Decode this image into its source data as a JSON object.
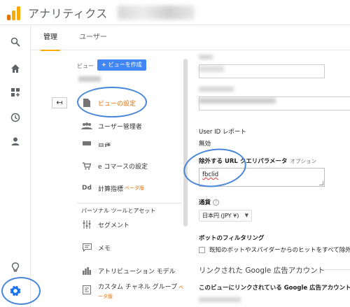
{
  "app": {
    "title": "アナリティクス"
  },
  "leftnav": {
    "items": [
      "search-icon",
      "home-icon",
      "customization-icon",
      "realtime-icon",
      "audience-icon",
      "discover-icon",
      "admin-gear-icon"
    ]
  },
  "tabs": [
    {
      "label": "管理",
      "active": true
    },
    {
      "label": "ユーザー",
      "active": false
    }
  ],
  "view_column": {
    "label": "ビュー",
    "create_button": "ビューを作成",
    "menu": [
      {
        "label": "ビューの設定",
        "icon": "document-icon",
        "active": true
      },
      {
        "label": "ユーザー管理者",
        "icon": "users-icon"
      },
      {
        "label": "目標",
        "icon": "flag-icon"
      },
      {
        "label": "e コマースの設定",
        "icon": "cart-icon"
      },
      {
        "label": "計算指標",
        "beta": "ベータ版",
        "icon": "dd-icon"
      }
    ],
    "personal_section": "パーソナル ツールとアセット",
    "personal_menu": [
      {
        "label": "セグメント",
        "icon": "segment-icon"
      },
      {
        "label": "メモ",
        "icon": "annotation-icon"
      },
      {
        "label": "アトリビューション モデル",
        "icon": "bar-chart-icon"
      },
      {
        "label": "カスタム チャネル グループ",
        "beta": "ベータ版",
        "icon": "channel-group-icon"
      }
    ]
  },
  "settings": {
    "user_id_report_label": "User ID レポート",
    "user_id_report_value": "無効",
    "exclude_param_label": "除外する URL クエリパラメータ",
    "exclude_param_optional": "オプション",
    "exclude_param_value": "fbclid",
    "currency_label": "通貨",
    "currency_value": "日本円 (JPY ¥)",
    "bot_filter_label": "ボットのフィルタリング",
    "bot_filter_checkbox_label": "既知のボットやスパイダーからのヒットをすべて除外",
    "google_ads_section": "リンクされた Google 広告アカウント",
    "google_ads_desc": "このビューにリンクされている Google 広告アカウント"
  },
  "colors": {
    "accent_orange": "#e8710a",
    "primary_blue": "#4285f4",
    "highlight_circle": "#4a86d8"
  }
}
